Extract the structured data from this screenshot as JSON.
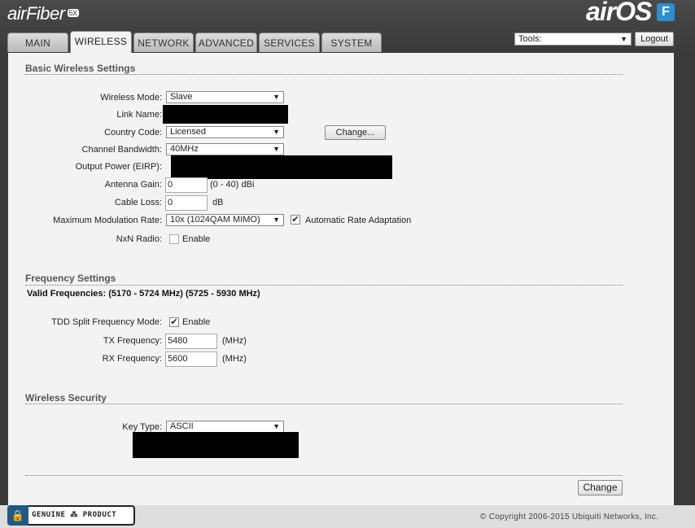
{
  "header": {
    "brand": "airFiber",
    "brand_sub": "5X",
    "os_logo": "airOS",
    "os_badge": "F"
  },
  "tabs": [
    {
      "label": "MAIN",
      "active": false
    },
    {
      "label": "WIRELESS",
      "active": true
    },
    {
      "label": "NETWORK",
      "active": false
    },
    {
      "label": "ADVANCED",
      "active": false
    },
    {
      "label": "SERVICES",
      "active": false
    },
    {
      "label": "SYSTEM",
      "active": false
    }
  ],
  "tools": {
    "selected": "Tools:",
    "logout_label": "Logout"
  },
  "basic": {
    "title": "Basic Wireless Settings",
    "wireless_mode_label": "Wireless Mode:",
    "wireless_mode": "Slave",
    "link_name_label": "Link Name:",
    "country_code_label": "Country Code:",
    "country_code": "Licensed",
    "change_label": "Change...",
    "channel_bandwidth_label": "Channel Bandwidth:",
    "channel_bandwidth": "40MHz",
    "output_power_label": "Output Power (EIRP):",
    "antenna_gain_label": "Antenna Gain:",
    "antenna_gain": "0",
    "antenna_gain_unit": "(0 - 40) dBi",
    "cable_loss_label": "Cable Loss:",
    "cable_loss": "0",
    "cable_loss_unit": "dB",
    "max_mod_label": "Maximum Modulation Rate:",
    "max_mod": "10x (1024QAM MIMO)",
    "auto_rate_label": "Automatic Rate Adaptation",
    "auto_rate_checked": true,
    "nxn_label": "NxN Radio:",
    "nxn_enable_label": "Enable",
    "nxn_checked": false
  },
  "frequency": {
    "title": "Frequency Settings",
    "valid": "Valid Frequencies: (5170 - 5724 MHz) (5725 - 5930 MHz)",
    "tdd_label": "TDD Split Frequency Mode:",
    "tdd_enable_label": "Enable",
    "tdd_checked": true,
    "tx_label": "TX Frequency:",
    "tx": "5480",
    "tx_unit": "(MHz)",
    "rx_label": "RX Frequency:",
    "rx": "5600",
    "rx_unit": "(MHz)"
  },
  "security": {
    "title": "Wireless Security",
    "key_type_label": "Key Type:",
    "key_type": "ASCII"
  },
  "actions": {
    "change_label": "Change"
  },
  "footer": {
    "genuine": "GENUINE ⁂ PRODUCT",
    "copyright": "© Copyright 2006-2015 Ubiquiti Networks, Inc."
  }
}
